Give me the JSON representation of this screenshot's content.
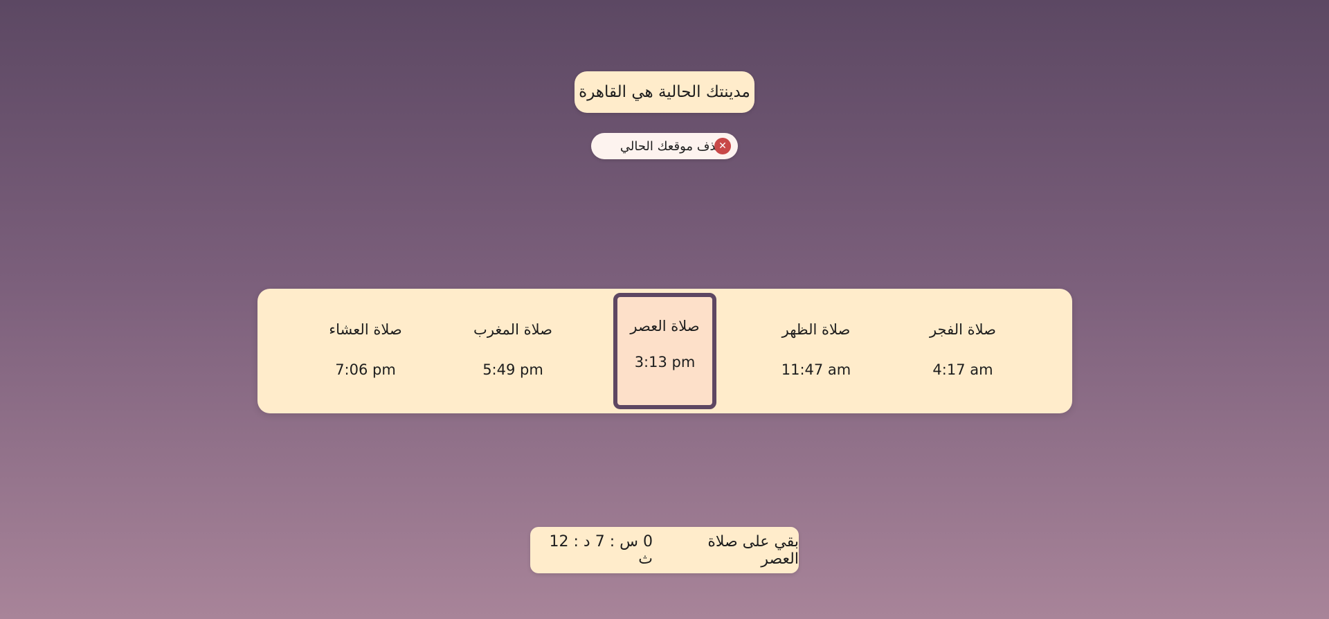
{
  "location": {
    "current_city_text": "مدينتك الحالية هي القاهرة",
    "remove_location_label": "حذف موقعك الحالي",
    "remove_icon": "close-icon",
    "remove_icon_glyph": "✕"
  },
  "prayers": [
    {
      "name": "صلاة الفجر",
      "time": "4:17 am"
    },
    {
      "name": "صلاة الظهر",
      "time": "11:47 am"
    },
    {
      "name": "صلاة العصر",
      "time": "3:13 pm"
    },
    {
      "name": "صلاة المغرب",
      "time": "5:49 pm"
    },
    {
      "name": "صلاة العشاء",
      "time": "7:06 pm"
    }
  ],
  "active_prayer_index": 2,
  "countdown": {
    "prefix": "بقي على صلاة العصر",
    "remaining": "0 س : 7 د : 12 ث"
  },
  "colors": {
    "card_background": "#ffeccb",
    "active_card_background": "#fde0c9",
    "active_border": "#5e4762",
    "remove_icon_bg": "#c84848",
    "page_gradient_top": "#5c4863",
    "page_gradient_bottom": "#a88499"
  }
}
